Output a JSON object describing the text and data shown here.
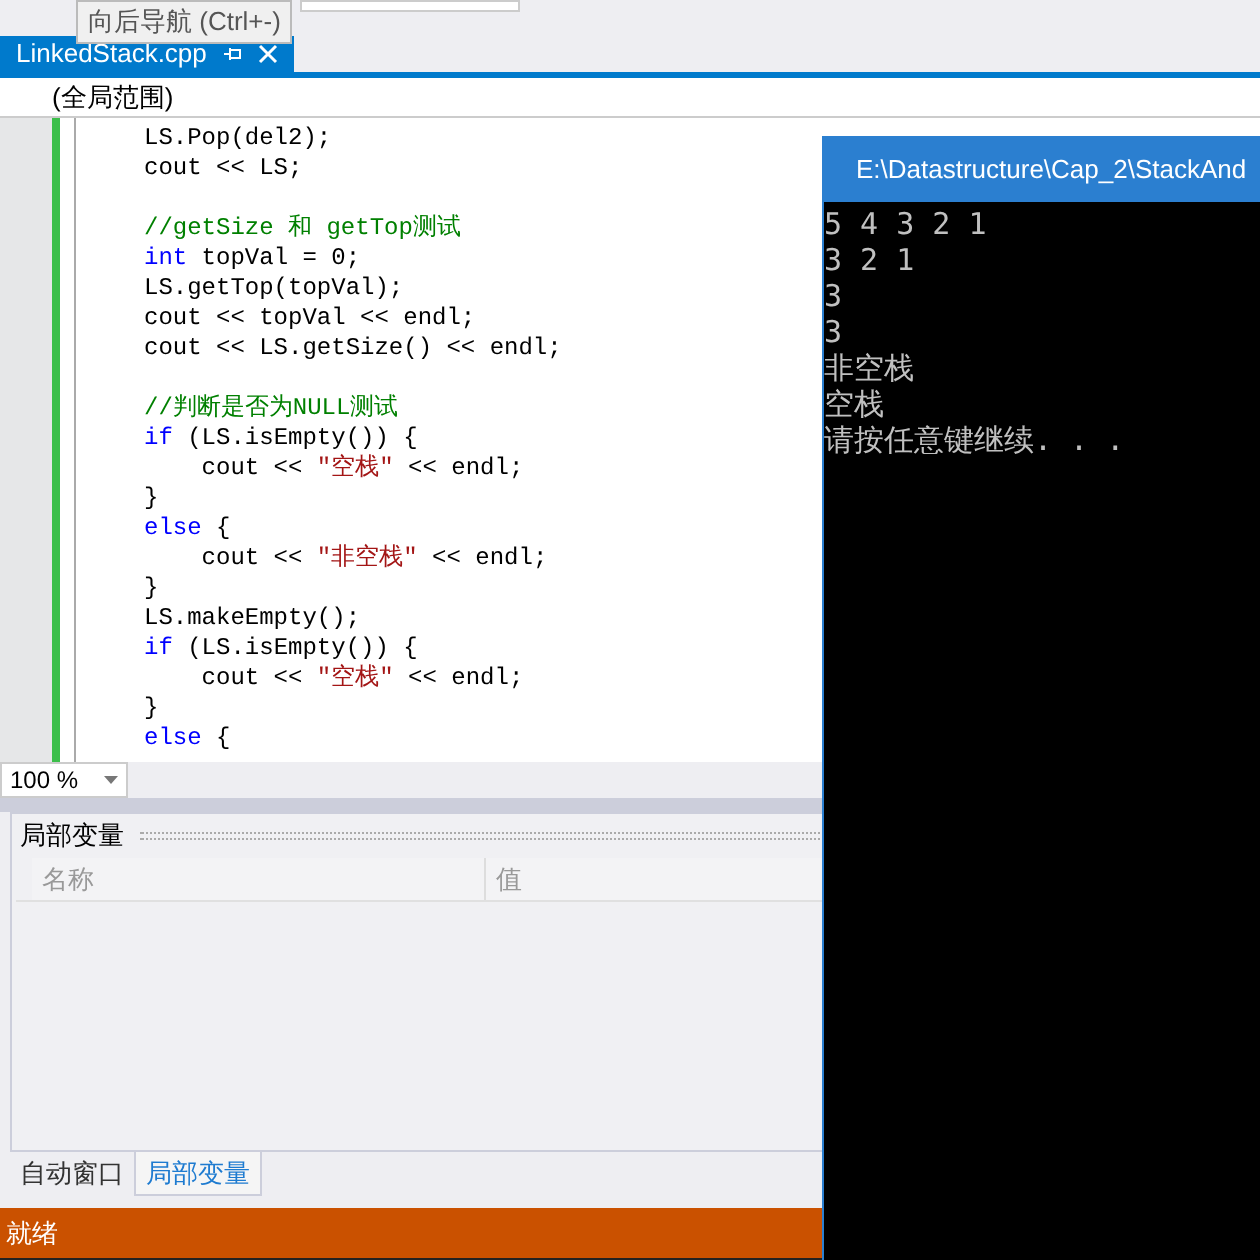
{
  "tooltip": "向后导航 (Ctrl+-)",
  "editor_tab": {
    "title": "LinkedStack.cpp",
    "selected": true
  },
  "scope": "(全局范围)",
  "code_lines": [
    [
      {
        "kind": "plain",
        "text": "LS.Pop(del2);"
      }
    ],
    [
      {
        "kind": "plain",
        "text": "cout << LS;"
      }
    ],
    [
      {
        "kind": "blank"
      }
    ],
    [
      {
        "kind": "comment",
        "text": "//getSize 和 getTop测试"
      }
    ],
    [
      {
        "kind": "keyword",
        "text": "int"
      },
      {
        "kind": "plain",
        "text": " topVal = 0;"
      }
    ],
    [
      {
        "kind": "plain",
        "text": "LS.getTop(topVal);"
      }
    ],
    [
      {
        "kind": "plain",
        "text": "cout << topVal << endl;"
      }
    ],
    [
      {
        "kind": "plain",
        "text": "cout << LS.getSize() << endl;"
      }
    ],
    [
      {
        "kind": "blank"
      }
    ],
    [
      {
        "kind": "comment",
        "text": "//判断是否为NULL测试"
      }
    ],
    [
      {
        "kind": "keyword",
        "text": "if"
      },
      {
        "kind": "plain",
        "text": " (LS.isEmpty()) {"
      }
    ],
    [
      {
        "kind": "plain",
        "text": "    cout << "
      },
      {
        "kind": "string",
        "text": "\"空栈\""
      },
      {
        "kind": "plain",
        "text": " << endl;"
      }
    ],
    [
      {
        "kind": "plain",
        "text": "}"
      }
    ],
    [
      {
        "kind": "keyword",
        "text": "else"
      },
      {
        "kind": "plain",
        "text": " {"
      }
    ],
    [
      {
        "kind": "plain",
        "text": "    cout << "
      },
      {
        "kind": "string",
        "text": "\"非空栈\""
      },
      {
        "kind": "plain",
        "text": " << endl;"
      }
    ],
    [
      {
        "kind": "plain",
        "text": "}"
      }
    ],
    [
      {
        "kind": "plain",
        "text": "LS.makeEmpty();"
      }
    ],
    [
      {
        "kind": "keyword",
        "text": "if"
      },
      {
        "kind": "plain",
        "text": " (LS.isEmpty()) {"
      }
    ],
    [
      {
        "kind": "plain",
        "text": "    cout << "
      },
      {
        "kind": "string",
        "text": "\"空栈\""
      },
      {
        "kind": "plain",
        "text": " << endl;"
      }
    ],
    [
      {
        "kind": "plain",
        "text": "}"
      }
    ],
    [
      {
        "kind": "keyword",
        "text": "else"
      },
      {
        "kind": "plain",
        "text": " {"
      }
    ]
  ],
  "zoom": "100 %",
  "locals_panel": {
    "title": "局部变量",
    "columns": [
      "名称",
      "值"
    ]
  },
  "bottom_tabs": [
    {
      "label": "自动窗口",
      "selected": false
    },
    {
      "label": "局部变量",
      "selected": true
    }
  ],
  "status_bar": "就绪",
  "console": {
    "title": "E:\\Datastructure\\Cap_2\\StackAnd",
    "lines": [
      "5 4 3 2 1",
      "3 2 1",
      "3",
      "3",
      "非空栈",
      "空栈",
      "请按任意键继续. . ."
    ]
  }
}
